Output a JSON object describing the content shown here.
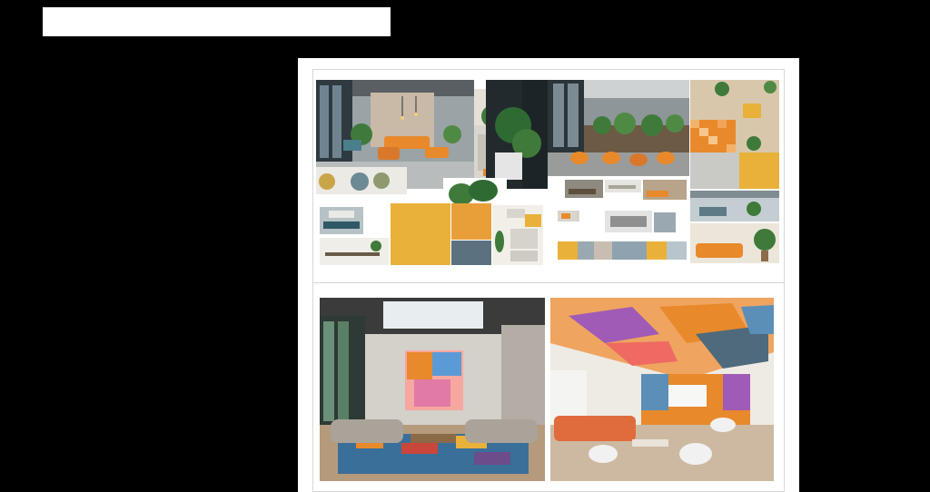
{
  "header": {
    "title": ""
  },
  "colors": {
    "orange": "#e8892b",
    "mustard": "#e9b13a",
    "slate": "#5b7180",
    "cream": "#f2ead9",
    "plant_green": "#3f7a3a",
    "rug_red": "#c9463a"
  },
  "moodboard": {
    "photos": [
      {
        "name": "lounge-orange-sofas-photo"
      },
      {
        "name": "cafe-orange-chairs-photo"
      },
      {
        "name": "wood-wall-plants-photo"
      },
      {
        "name": "swatch-mustard",
        "color": "#e9b13a"
      },
      {
        "name": "swatch-orange",
        "color": "#e89f3a"
      },
      {
        "name": "swatch-slate",
        "color": "#5b7180"
      }
    ]
  },
  "renders": [
    {
      "name": "atrium-lounge-render"
    },
    {
      "name": "colorful-ceiling-lounge-render"
    }
  ]
}
